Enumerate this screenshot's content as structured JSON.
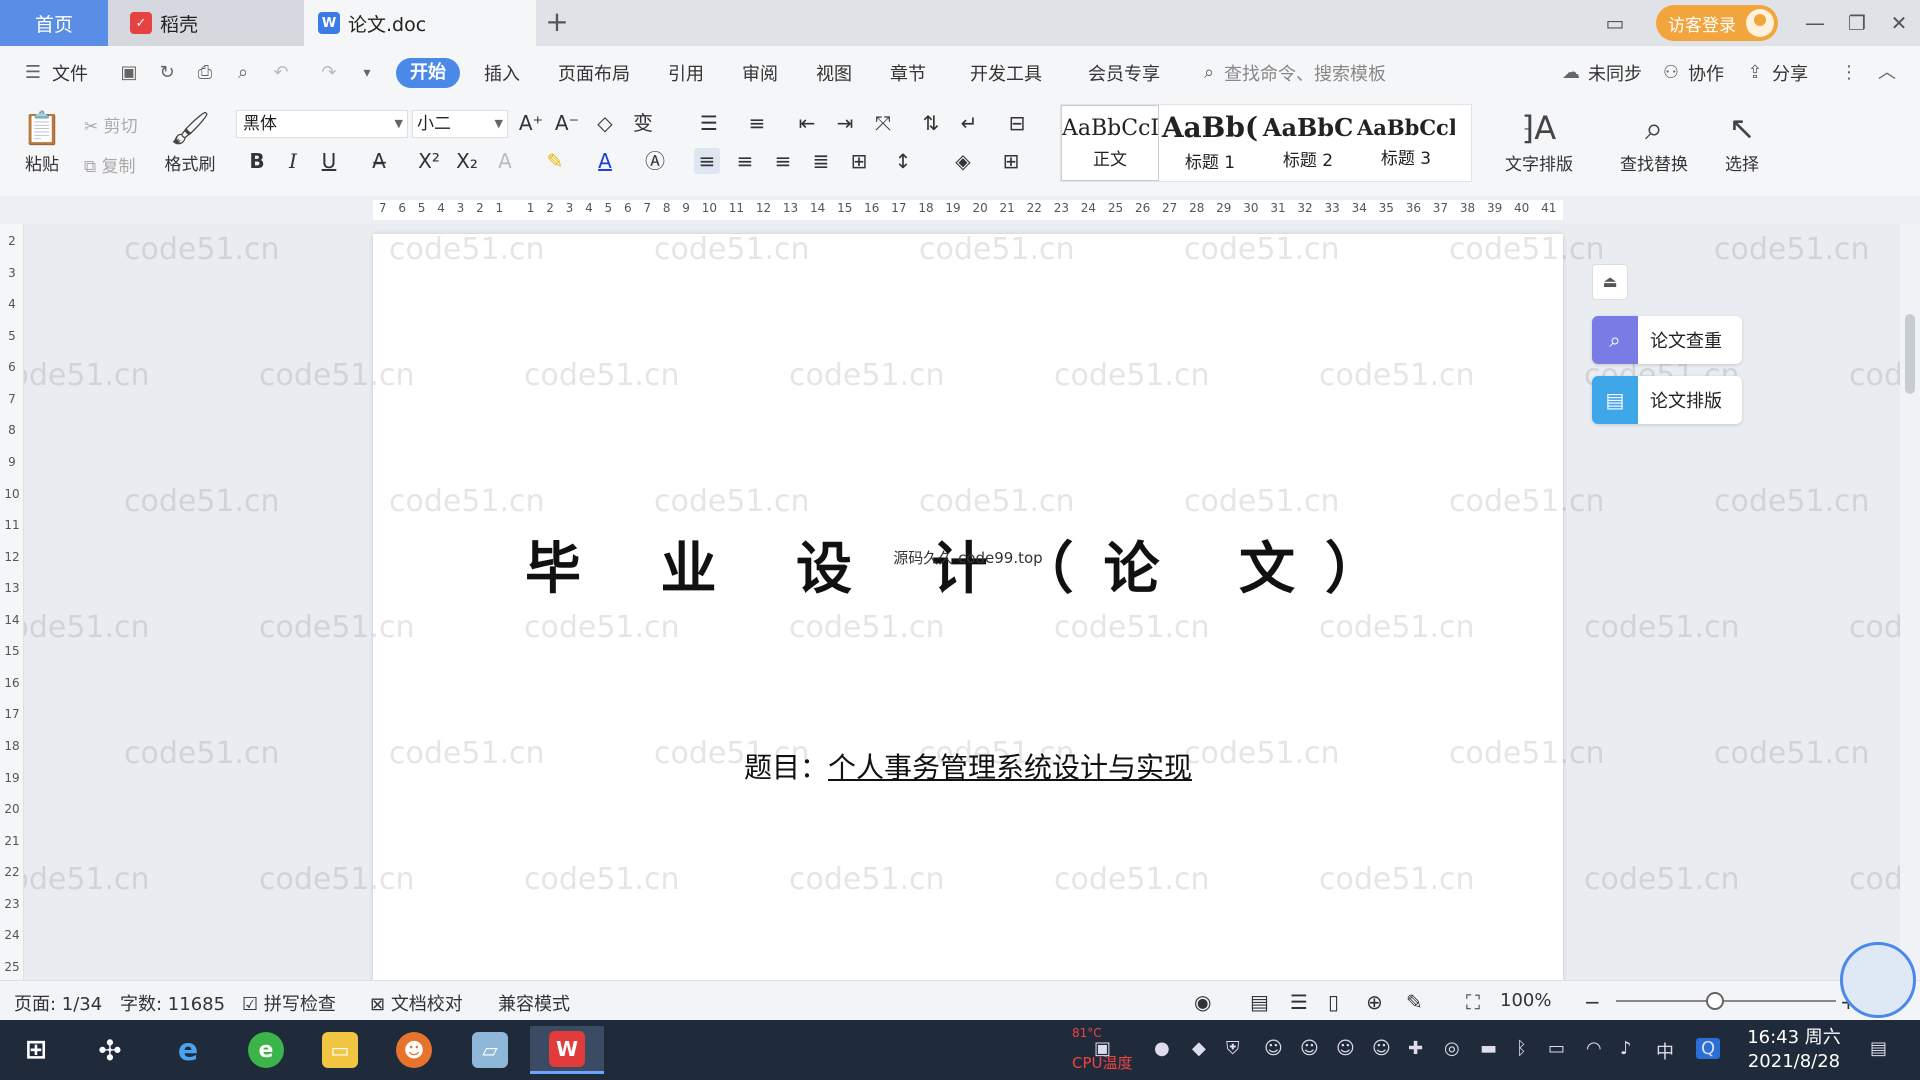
{
  "tabs": {
    "home": "首页",
    "daoke": "稻壳",
    "doc": "论文.doc",
    "plus": "+"
  },
  "header": {
    "guest_login": "访客登录"
  },
  "menu": {
    "file": "文件",
    "items": [
      "开始",
      "插入",
      "页面布局",
      "引用",
      "审阅",
      "视图",
      "章节",
      "开发工具",
      "会员专享"
    ],
    "search_placeholder": "查找命令、搜索模板",
    "not_synced": "未同步",
    "collaborate": "协作",
    "share": "分享"
  },
  "ribbon": {
    "paste": "粘贴",
    "cut": "剪切",
    "copy": "复制",
    "format_painter": "格式刷",
    "font_name": "黑体",
    "font_size": "小二",
    "styles": [
      {
        "sample": "AaBbCcI",
        "name": "正文"
      },
      {
        "sample": "AaBb(",
        "name": "标题 1"
      },
      {
        "sample": "AaBbC",
        "name": "标题 2"
      },
      {
        "sample": "AaBbCcl",
        "name": "标题 3"
      }
    ],
    "text_layout": "文字排版",
    "find_replace": "查找替换",
    "select": "选择"
  },
  "ruler": {
    "h": [
      "7",
      "6",
      "5",
      "4",
      "3",
      "2",
      "1",
      "",
      "1",
      "2",
      "3",
      "4",
      "5",
      "6",
      "7",
      "8",
      "9",
      "10",
      "11",
      "12",
      "13",
      "14",
      "15",
      "16",
      "17",
      "18",
      "19",
      "20",
      "21",
      "22",
      "23",
      "24",
      "25",
      "26",
      "27",
      "28",
      "29",
      "30",
      "31",
      "32",
      "33",
      "34",
      "35",
      "36",
      "37",
      "38",
      "39",
      "40",
      "41"
    ],
    "v": [
      "2",
      "3",
      "4",
      "5",
      "6",
      "7",
      "8",
      "9",
      "10",
      "11",
      "12",
      "13",
      "14",
      "15",
      "16",
      "17",
      "18",
      "19",
      "20",
      "21",
      "22",
      "23",
      "24",
      "25"
    ]
  },
  "document": {
    "title": "毕 业 设 计（论 文）",
    "overlay_text": "源码久久 code99.top",
    "topic_label": "题目：",
    "topic_value": "个人事务管理系统设计与实现"
  },
  "watermark": "code51.cn",
  "side_panel": {
    "plagiarism_check": "论文查重",
    "paper_format": "论文排版"
  },
  "status": {
    "page": "页面: 1/34",
    "word_count": "字数: 11685",
    "spell_check": "拼写检查",
    "doc_proof": "文档校对",
    "compat_mode": "兼容模式",
    "zoom": "100%"
  },
  "taskbar": {
    "cpu_temp": "81°C",
    "cpu_label": "CPU温度",
    "ime": "中",
    "time": "16:43 周六",
    "date": "2021/8/28"
  },
  "colors": {
    "accent": "#4a89e8",
    "guest": "#f2a53d",
    "taskbar": "#1f2a3a"
  }
}
